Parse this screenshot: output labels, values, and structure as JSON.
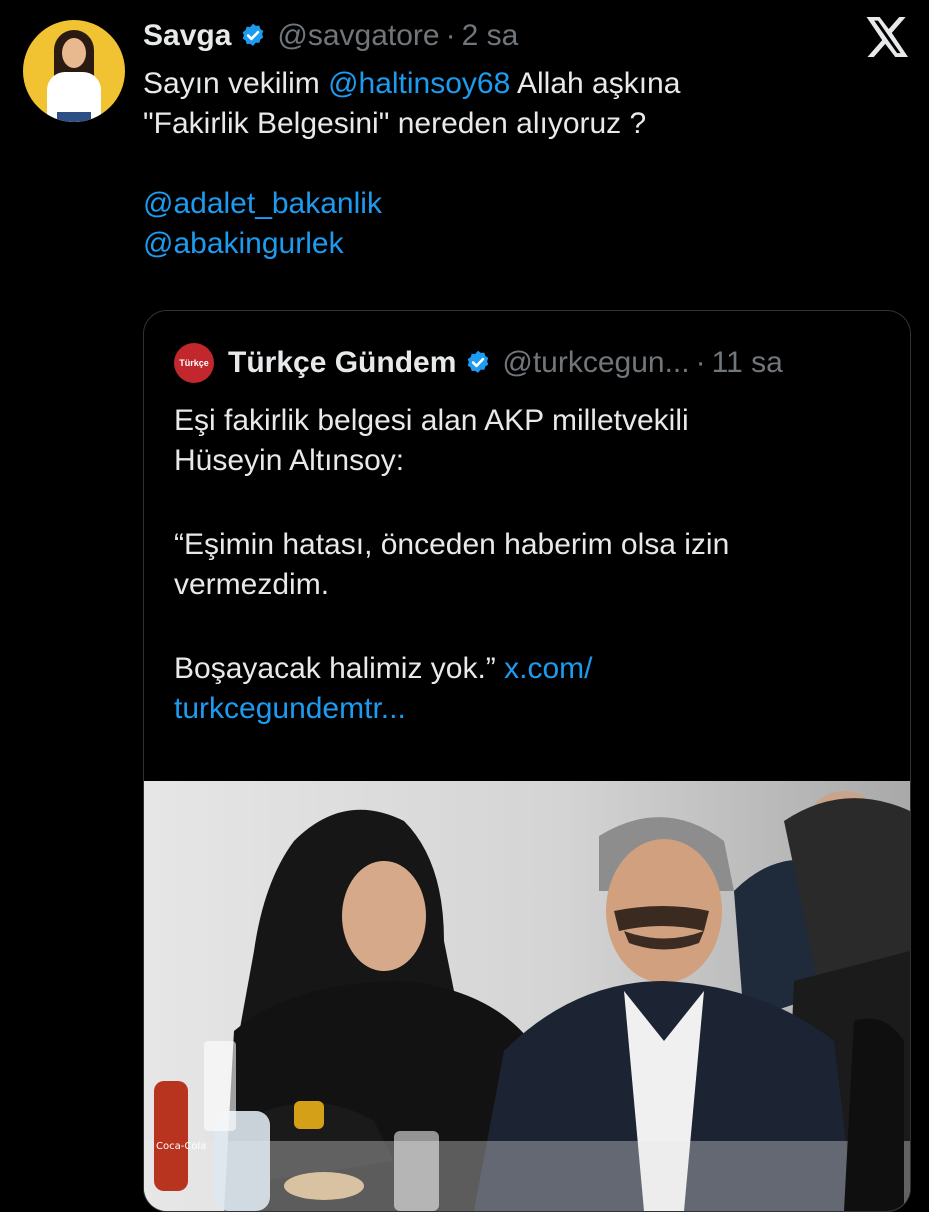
{
  "tweet": {
    "author_name": "Savga",
    "handle": "@savgatore",
    "separator": "·",
    "time": "2 sa",
    "text_lines": [
      [
        {
          "t": "Sayın vekilim "
        },
        {
          "t": "@haltinsoy68",
          "link": true
        },
        {
          "t": " Allah aşkına"
        }
      ],
      [
        {
          "t": "\"Fakirlik Belgesini\" nereden alıyoruz ?"
        }
      ],
      [],
      [
        {
          "t": "@adalet_bakanlik",
          "link": true
        }
      ],
      [
        {
          "t": "@abakingurlek",
          "link": true
        }
      ]
    ]
  },
  "quote": {
    "logo_text": "Türkçe",
    "author_name": "Türkçe Gündem",
    "handle": "@turkcegun...",
    "separator": "·",
    "time": "11 sa",
    "line1": "Eşi fakirlik belgesi alan AKP milletvekili",
    "line2": "Hüseyin Altınsoy:",
    "line3": "“Eşimin hatası, önceden haberim olsa izin",
    "line4": "vermezdim.",
    "line5": "Boşayacak halimiz yok.”",
    "link_part1": "x.com/",
    "link_part2": "turkcegundemtr..."
  },
  "colors": {
    "background": "#000000",
    "text": "#e7e9ea",
    "muted": "#71767b",
    "link": "#1d9bf0",
    "verified": "#1d9bf0"
  },
  "icons": {
    "verified": "verified-badge-icon",
    "platform": "x-logo-icon"
  },
  "bottle_label": "Coca-Cola"
}
